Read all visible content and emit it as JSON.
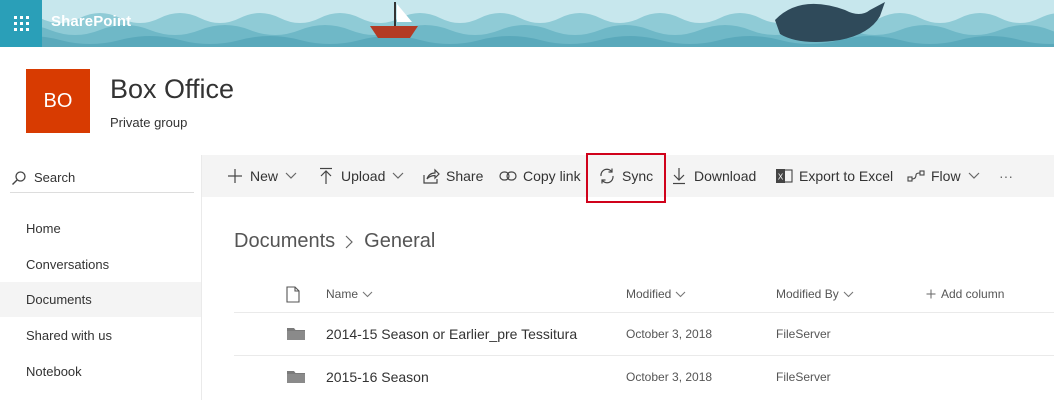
{
  "suite": {
    "brand": "SharePoint",
    "icons": [
      "waffle-icon"
    ]
  },
  "site": {
    "logo_text": "BO",
    "logo_color": "#d83b01",
    "title": "Box Office",
    "subtitle": "Private group"
  },
  "leftnav": {
    "search_label": "Search",
    "items": [
      {
        "label": "Home",
        "selected": false
      },
      {
        "label": "Conversations",
        "selected": false
      },
      {
        "label": "Documents",
        "selected": true
      },
      {
        "label": "Shared with us",
        "selected": false
      },
      {
        "label": "Notebook",
        "selected": false
      }
    ]
  },
  "commandbar": {
    "new": "New",
    "upload": "Upload",
    "share": "Share",
    "copy_link": "Copy link",
    "sync": "Sync",
    "download": "Download",
    "export": "Export to Excel",
    "flow": "Flow",
    "more": "···"
  },
  "breadcrumb": {
    "root": "Documents",
    "current": "General"
  },
  "columns": {
    "name": "Name",
    "modified": "Modified",
    "modified_by": "Modified By",
    "add_column": "Add column"
  },
  "rows": [
    {
      "name": "2014-15 Season or Earlier_pre Tessitura",
      "modified": "October 3, 2018",
      "modified_by": "FileServer"
    },
    {
      "name": "2015-16 Season",
      "modified": "October 3, 2018",
      "modified_by": "FileServer"
    }
  ],
  "colors": {
    "highlight": "#d0021b",
    "suite_bar": "#2a9fb8"
  }
}
